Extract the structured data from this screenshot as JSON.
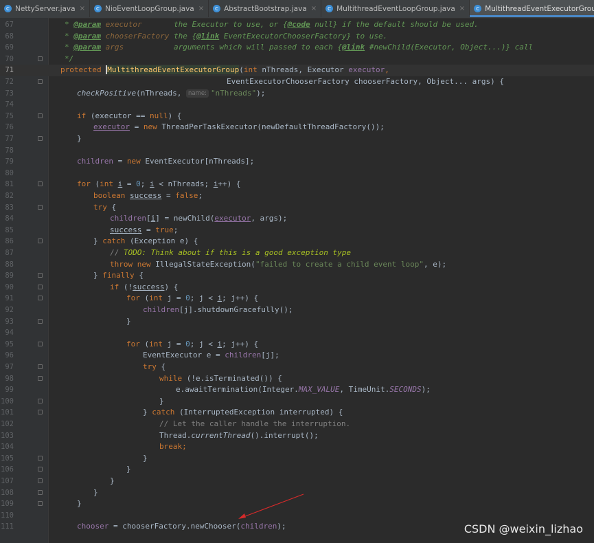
{
  "tabs": [
    {
      "label": "NettyServer.java",
      "active": false
    },
    {
      "label": "NioEventLoopGroup.java",
      "active": false
    },
    {
      "label": "AbstractBootstrap.java",
      "active": false
    },
    {
      "label": "MultithreadEventLoopGroup.java",
      "active": false
    },
    {
      "label": "MultithreadEventExecutorGroup.java",
      "active": true
    }
  ],
  "tab_icon": "class-icon",
  "line_numbers": [
    "67",
    "68",
    "69",
    "70",
    "71",
    "72",
    "73",
    "74",
    "75",
    "76",
    "77",
    "78",
    "79",
    "80",
    "81",
    "82",
    "83",
    "84",
    "85",
    "86",
    "87",
    "88",
    "89",
    "90",
    "91",
    "92",
    "93",
    "94",
    "95",
    "96",
    "97",
    "98",
    "99",
    "100",
    "101",
    "102",
    "103",
    "104",
    "105",
    "106",
    "107",
    "108",
    "109",
    "110",
    "111"
  ],
  "current_line": "71",
  "code": {
    "l67": {
      "star": "* ",
      "tag": "@param",
      "name": " executor",
      "text": "       the Executor to use, or {",
      "code": "@code",
      "rest": " null} if the default should be used."
    },
    "l68": {
      "star": "* ",
      "tag": "@param",
      "name": " chooserFactory",
      "text": " the {",
      "link": "@link",
      "rest": " EventExecutorChooserFactory} to use."
    },
    "l69": {
      "star": "* ",
      "tag": "@param",
      "name": " args",
      "text": "           arguments which will passed to each {",
      "link": "@link",
      "rest": " #newChild(Executor, Object...)} call"
    },
    "l70": {
      "text": "*/"
    },
    "l71": {
      "kw": "protected ",
      "name": "MultithreadEventExecutorGroup",
      "p1": "(",
      "t1": "int",
      "p2": " nThreads, Executor ",
      "p3": "executor",
      ",": ","
    },
    "l72": {
      "text": "EventExecutorChooserFactory chooserFactory, Object... args) {"
    },
    "l73": {
      "fn": "checkPositive",
      "p1": "(nThreads, ",
      "hint": "name:",
      "str": "\"nThreads\"",
      "p2": ");"
    },
    "l75": {
      "kw": "if",
      "p1": " (executor == ",
      "null": "null",
      "p2": ") {"
    },
    "l76": {
      "fld": "executor",
      "p1": " = ",
      "kw": "new",
      "p2": " ThreadPerTaskExecutor(newDefaultThreadFactory());"
    },
    "l77": {
      "text": "}"
    },
    "l79": {
      "fld": "children",
      "p1": " = ",
      "kw": "new",
      "p2": " EventExecutor[nThreads];"
    },
    "l81": {
      "kw": "for",
      "p1": " (",
      "t": "int",
      "p2": " ",
      "i": "i",
      "p3": " = ",
      "n": "0",
      "p4": "; ",
      "i2": "i",
      "p5": " < nThreads; ",
      "i3": "i",
      "p6": "++) {"
    },
    "l82": {
      "kw": "boolean",
      "p1": " ",
      "v": "success",
      "p2": " = ",
      "f": "false",
      "p3": ";"
    },
    "l83": {
      "kw": "try",
      "p1": " {"
    },
    "l84": {
      "fld": "children",
      "p1": "[",
      "i": "i",
      "p2": "] = newChild(",
      "ex": "executor",
      "p3": ", args);"
    },
    "l85": {
      "v": "success",
      "p1": " = ",
      "t": "true",
      "p2": ";"
    },
    "l86": {
      "p1": "} ",
      "kw": "catch",
      "p2": " (Exception e) {"
    },
    "l87": {
      "c1": "// ",
      "todo": "TODO: Think about if this is a good exception type"
    },
    "l88": {
      "kw": "throw new",
      "p1": " IllegalStateException(",
      "str": "\"failed to create a child event loop\"",
      "p2": ", e);"
    },
    "l89": {
      "p1": "} ",
      "kw": "finally",
      "p2": " {"
    },
    "l90": {
      "kw": "if",
      "p1": " (!",
      "v": "success",
      "p2": ") {"
    },
    "l91": {
      "kw": "for",
      "p1": " (",
      "t": "int",
      "p2": " j = ",
      "n": "0",
      "p3": "; j < ",
      "i": "i",
      "p4": "; j++) {"
    },
    "l92": {
      "fld": "children",
      "p1": "[j].shutdownGracefully();"
    },
    "l93": {
      "text": "}"
    },
    "l95": {
      "kw": "for",
      "p1": " (",
      "t": "int",
      "p2": " j = ",
      "n": "0",
      "p3": "; j < ",
      "i": "i",
      "p4": "; j++) {"
    },
    "l96": {
      "p1": "EventExecutor e = ",
      "fld": "children",
      "p2": "[j];"
    },
    "l97": {
      "kw": "try",
      "p1": " {"
    },
    "l98": {
      "kw": "while",
      "p1": " (!e.isTerminated()) {"
    },
    "l99": {
      "p1": "e.awaitTermination(Integer.",
      "s1": "MAX_VALUE",
      "p2": ", TimeUnit.",
      "s2": "SECONDS",
      "p3": ");"
    },
    "l100": {
      "text": "}"
    },
    "l101": {
      "p1": "} ",
      "kw": "catch",
      "p2": " (InterruptedException interrupted) {"
    },
    "l102": {
      "text": "// Let the caller handle the interruption."
    },
    "l103": {
      "p1": "Thread.",
      "it": "currentThread",
      "p2": "().interrupt();"
    },
    "l104": {
      "kw": "break",
      "p1": ";"
    },
    "l105": {
      "text": "}"
    },
    "l106": {
      "text": "}"
    },
    "l107": {
      "text": "}"
    },
    "l108": {
      "text": "}"
    },
    "l109": {
      "text": "}"
    },
    "l111": {
      "fld": "chooser",
      "p1": " = chooserFactory.newChooser(",
      "fld2": "children",
      "p2": ");"
    }
  },
  "watermark": "CSDN @weixin_lizhao",
  "colors": {
    "background": "#2b2b2b",
    "keyword": "#cc7832",
    "field": "#9876aa",
    "string": "#6a8759",
    "annotation_arrow": "#d62a2a"
  }
}
